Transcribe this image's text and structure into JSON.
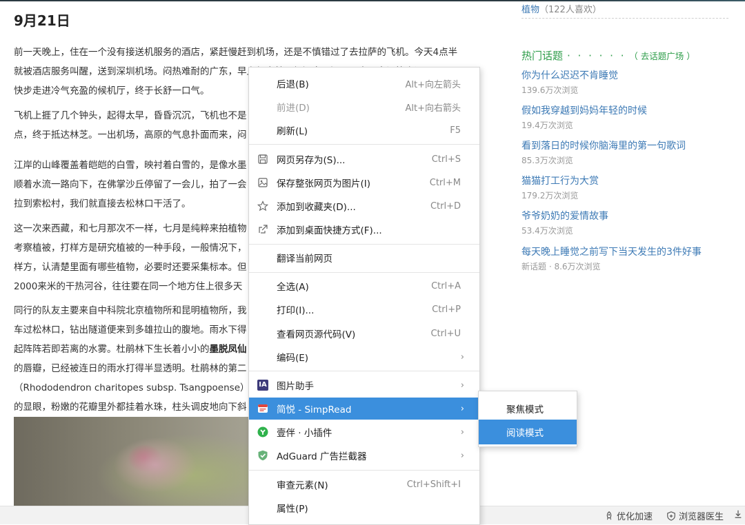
{
  "article": {
    "date": "9月21日",
    "paragraphs": [
      "前一天晚上，住在一个没有接送机服务的酒店，紧赶慢赶到机场，还是不慎错过了去拉萨的飞机。今天4点半\n就被酒店服务叫醒，送到深圳机场。闷热难耐的广东，早上起来就已经汗息层汗了，离开空调箱幸运不不\n快步走进冷气充盈的候机厅，终于长舒一口气。",
      "飞机上捱了几个钟头，起得太早，昏昏沉沉，飞机也不是\n点，终于抵达林芝。一出机场，高原的气息扑面而来，闷",
      "江岸的山峰覆盖着皑皑的白雪，映衬着白雪的，是像水墨\n顺着水流一路向下，在佛掌沙丘停留了一会儿，拍了一会\n拉到索松村，我们就直接去松林口干活了。",
      "这一次来西藏，和七月那次不一样，七月是纯粹来拍植物\n考察植被，打样方是研究植被的一种手段，一般情况下，\n样方，认清楚里面有哪些植物，必要时还要采集标本。但\n2000来米的干热河谷，往往要在同一个地方住上很多天",
      "同行的队友主要来自中科院北京植物所和昆明植物所，我\n车过松林口，钻出隧道便来到多雄拉山的腹地。雨水下得\n起阵阵若即若离的水雾。杜鹃林下生长着小小的墨脱凤仙\n的唇瓣，已经被连日的雨水打得半显透明。杜鹃林的第二\n（Rhododendron charitopes subsp. Tsangpoense）的枝\n的显眼，粉嫩的花瓣里外都挂着水珠，柱头调皮地向下斜"
    ],
    "bold_fragment": "墨脱凤仙"
  },
  "sidebar": {
    "plant_link": "植物",
    "plant_likes": "（122人喜欢）",
    "hot_title": "热门话题",
    "hot_dots": "· · · · · ·",
    "hot_plaza": "（ 去话题广场 ）",
    "topics": [
      {
        "title": "你为什么迟迟不肯睡觉",
        "views": "139.6万次浏览"
      },
      {
        "title": "假如我穿越到妈妈年轻的时候",
        "views": "19.4万次浏览"
      },
      {
        "title": "看到落日的时候你脑海里的第一句歌词",
        "views": "85.3万次浏览"
      },
      {
        "title": "猫猫打工行为大赏",
        "views": "179.2万次浏览"
      },
      {
        "title": "爷爷奶奶的爱情故事",
        "views": "53.4万次浏览"
      },
      {
        "title": "每天晚上睡觉之前写下当天发生的3件好事",
        "views": "新话题 · 8.6万次浏览"
      }
    ]
  },
  "context_menu": {
    "back": {
      "label": "后退(B)",
      "shortcut": "Alt+向左箭头"
    },
    "forward": {
      "label": "前进(D)",
      "shortcut": "Alt+向右箭头"
    },
    "refresh": {
      "label": "刷新(L)",
      "shortcut": "F5"
    },
    "save_as": {
      "label": "网页另存为(S)...",
      "shortcut": "Ctrl+S"
    },
    "save_image": {
      "label": "保存整张网页为图片(I)",
      "shortcut": "Ctrl+M"
    },
    "favorite": {
      "label": "添加到收藏夹(D)...",
      "shortcut": "Ctrl+D"
    },
    "desktop_shortcut": {
      "label": "添加到桌面快捷方式(F)..."
    },
    "translate": {
      "label": "翻译当前网页"
    },
    "select_all": {
      "label": "全选(A)",
      "shortcut": "Ctrl+A"
    },
    "print": {
      "label": "打印(I)...",
      "shortcut": "Ctrl+P"
    },
    "view_source": {
      "label": "查看网页源代码(V)",
      "shortcut": "Ctrl+U"
    },
    "encoding": {
      "label": "编码(E)"
    },
    "image_helper": {
      "label": "图片助手",
      "icon_text": "IA"
    },
    "simpread": {
      "label": "简悦 - SimpRead"
    },
    "yiban": {
      "label": "壹伴 · 小插件"
    },
    "adguard": {
      "label": "AdGuard 广告拦截器"
    },
    "inspect": {
      "label": "审查元素(N)",
      "shortcut": "Ctrl+Shift+I"
    },
    "properties": {
      "label": "属性(P)"
    },
    "arrow": "›"
  },
  "submenu": {
    "focus_mode": "聚焦模式",
    "reading_mode": "阅读模式"
  },
  "statusbar": {
    "speedup": "优化加速",
    "doctor": "浏览器医生"
  },
  "colors": {
    "menu_highlight": "#3b8fdd",
    "link_blue": "#3d7ab5",
    "hot_green": "#2e9d4a"
  }
}
